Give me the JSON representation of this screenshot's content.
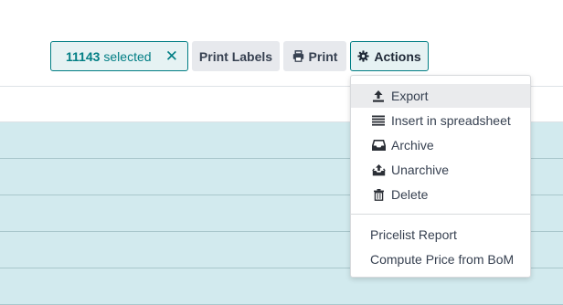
{
  "toolbar": {
    "selected_count": "11143",
    "selected_word": "selected",
    "clear_glyph": "✕",
    "print_labels": "Print Labels",
    "print": "Print",
    "actions": "Actions"
  },
  "icons": {
    "print": "printer-icon",
    "actions": "gear-icon",
    "export": "upload-icon",
    "insert": "list-icon",
    "archive": "inbox-icon",
    "unarchive": "unarchive-icon",
    "delete": "trash-icon"
  },
  "actions_menu": {
    "items": [
      {
        "label": "Export"
      },
      {
        "label": "Insert in spreadsheet"
      },
      {
        "label": "Archive"
      },
      {
        "label": "Unarchive"
      },
      {
        "label": "Delete"
      }
    ],
    "extra_items": [
      {
        "label": "Pricelist Report"
      },
      {
        "label": "Compute Price from BoM"
      }
    ]
  },
  "colors": {
    "accent": "#017e84",
    "selected_row": "#d2eaee",
    "button_gray": "#e7e9ed"
  }
}
